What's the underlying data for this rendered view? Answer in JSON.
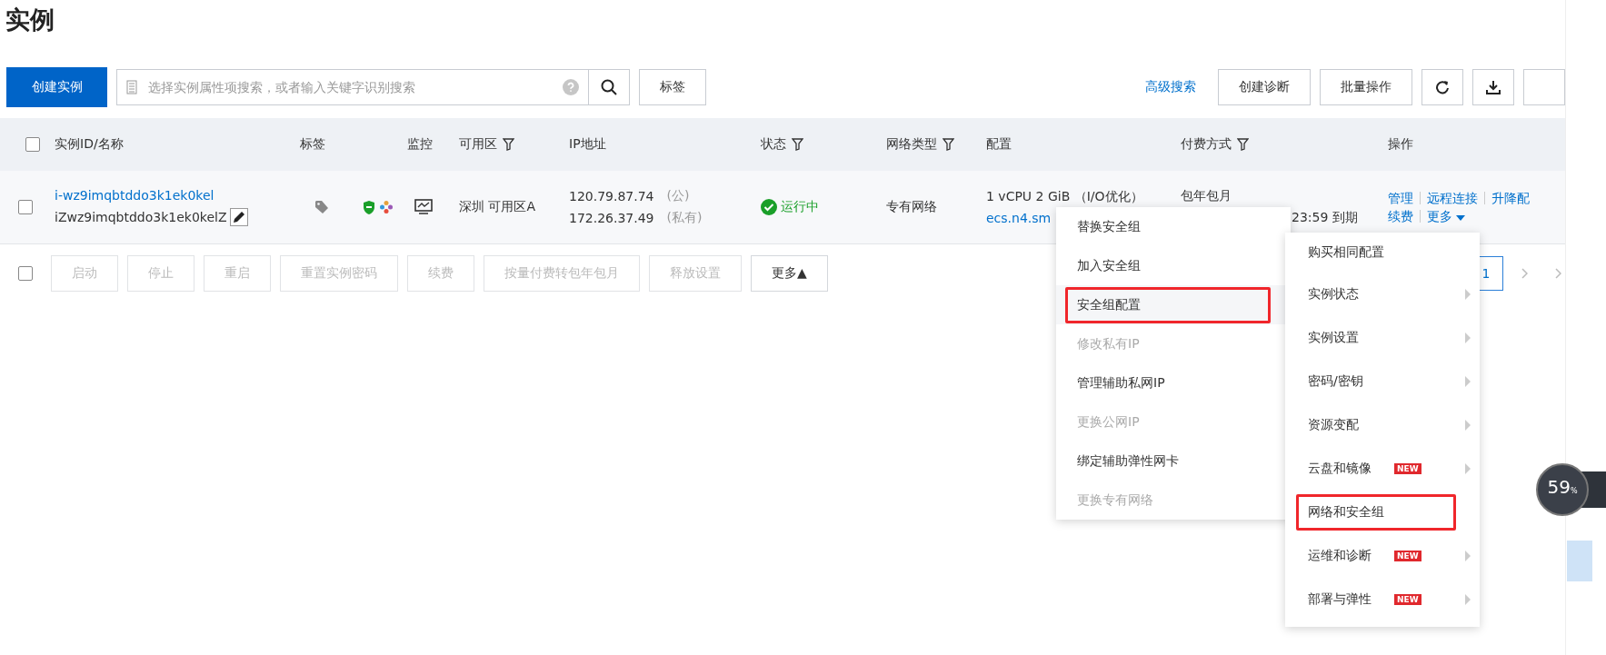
{
  "page_title": "实例",
  "toolbar": {
    "create_button": "创建实例",
    "search": {
      "placeholder": "选择实例属性项搜索，或者输入关键字识别搜索"
    },
    "tag_button": "标签",
    "advanced_search": "高级搜索",
    "buttons": [
      "创建诊断",
      "批量操作"
    ]
  },
  "table": {
    "header_checked": false,
    "columns": [
      {
        "label": "实例ID/名称",
        "filter": false
      },
      {
        "label": "标签",
        "filter": false
      },
      {
        "label": "监控",
        "filter": false
      },
      {
        "label": "可用区",
        "filter": true
      },
      {
        "label": "IP地址",
        "filter": false
      },
      {
        "label": "状态",
        "filter": true
      },
      {
        "label": "网络类型",
        "filter": true
      },
      {
        "label": "配置",
        "filter": false
      },
      {
        "label": "付费方式",
        "filter": true
      },
      {
        "label": "操作",
        "filter": false
      }
    ],
    "rows": [
      {
        "checked": false,
        "id": "i-wz9imqbtddo3k1ek0kel",
        "name": "iZwz9imqbtddo3k1ek0kelZ",
        "zone": "深圳 可用区A",
        "ips": [
          {
            "address": "120.79.87.74",
            "type": "(公)"
          },
          {
            "address": "172.26.37.49",
            "type": "(私有)"
          }
        ],
        "status": "运行中",
        "network": "专有网络",
        "config": "1 vCPU 2 GiB （I/O优化）",
        "spec": "ecs.n4.sm",
        "billing": "包年包月",
        "expiry": "23:59 到期",
        "actions": [
          [
            "管理",
            "远程连接",
            "升降配"
          ],
          [
            "续费",
            "更多"
          ]
        ]
      }
    ]
  },
  "batch": {
    "checked": false,
    "buttons": [
      {
        "label": "启动",
        "disabled": true
      },
      {
        "label": "停止",
        "disabled": true
      },
      {
        "label": "重启",
        "disabled": true
      },
      {
        "label": "重置实例密码",
        "disabled": true
      },
      {
        "label": "续费",
        "disabled": true
      },
      {
        "label": "按量付费转包年包月",
        "disabled": true
      },
      {
        "label": "释放设置",
        "disabled": true
      },
      {
        "label": "更多▲",
        "disabled": false
      }
    ]
  },
  "pagination": {
    "pages": [
      {
        "label": "1",
        "selected": true
      }
    ]
  },
  "security_menu": [
    {
      "label": "替换安全组",
      "disabled": false,
      "highlighted": false
    },
    {
      "label": "加入安全组",
      "disabled": false,
      "highlighted": false
    },
    {
      "label": "安全组配置",
      "disabled": false,
      "highlighted": true
    },
    {
      "label": "修改私有IP",
      "disabled": true,
      "highlighted": false
    },
    {
      "label": "管理辅助私网IP",
      "disabled": false,
      "highlighted": false
    },
    {
      "label": "更换公网IP",
      "disabled": true,
      "highlighted": false
    },
    {
      "label": "绑定辅助弹性网卡",
      "disabled": false,
      "highlighted": false
    },
    {
      "label": "更换专有网络",
      "disabled": true,
      "highlighted": false
    }
  ],
  "more_menu": [
    {
      "label": "购买相同配置",
      "submenu": false,
      "highlighted": false
    },
    {
      "label": "实例状态",
      "submenu": true,
      "highlighted": false
    },
    {
      "label": "实例设置",
      "submenu": true,
      "highlighted": false
    },
    {
      "label": "密码/密钥",
      "submenu": true,
      "highlighted": false
    },
    {
      "label": "资源变配",
      "submenu": true,
      "highlighted": false
    },
    {
      "label": "云盘和镜像",
      "submenu": true,
      "badge": "NEW",
      "highlighted": false
    },
    {
      "label": "网络和安全组",
      "submenu": false,
      "highlighted": true
    },
    {
      "label": "运维和诊断",
      "submenu": true,
      "badge": "NEW",
      "highlighted": false
    },
    {
      "label": "部署与弹性",
      "submenu": true,
      "badge": "NEW",
      "highlighted": false
    }
  ],
  "gauge": {
    "value": "59",
    "unit": "%"
  }
}
